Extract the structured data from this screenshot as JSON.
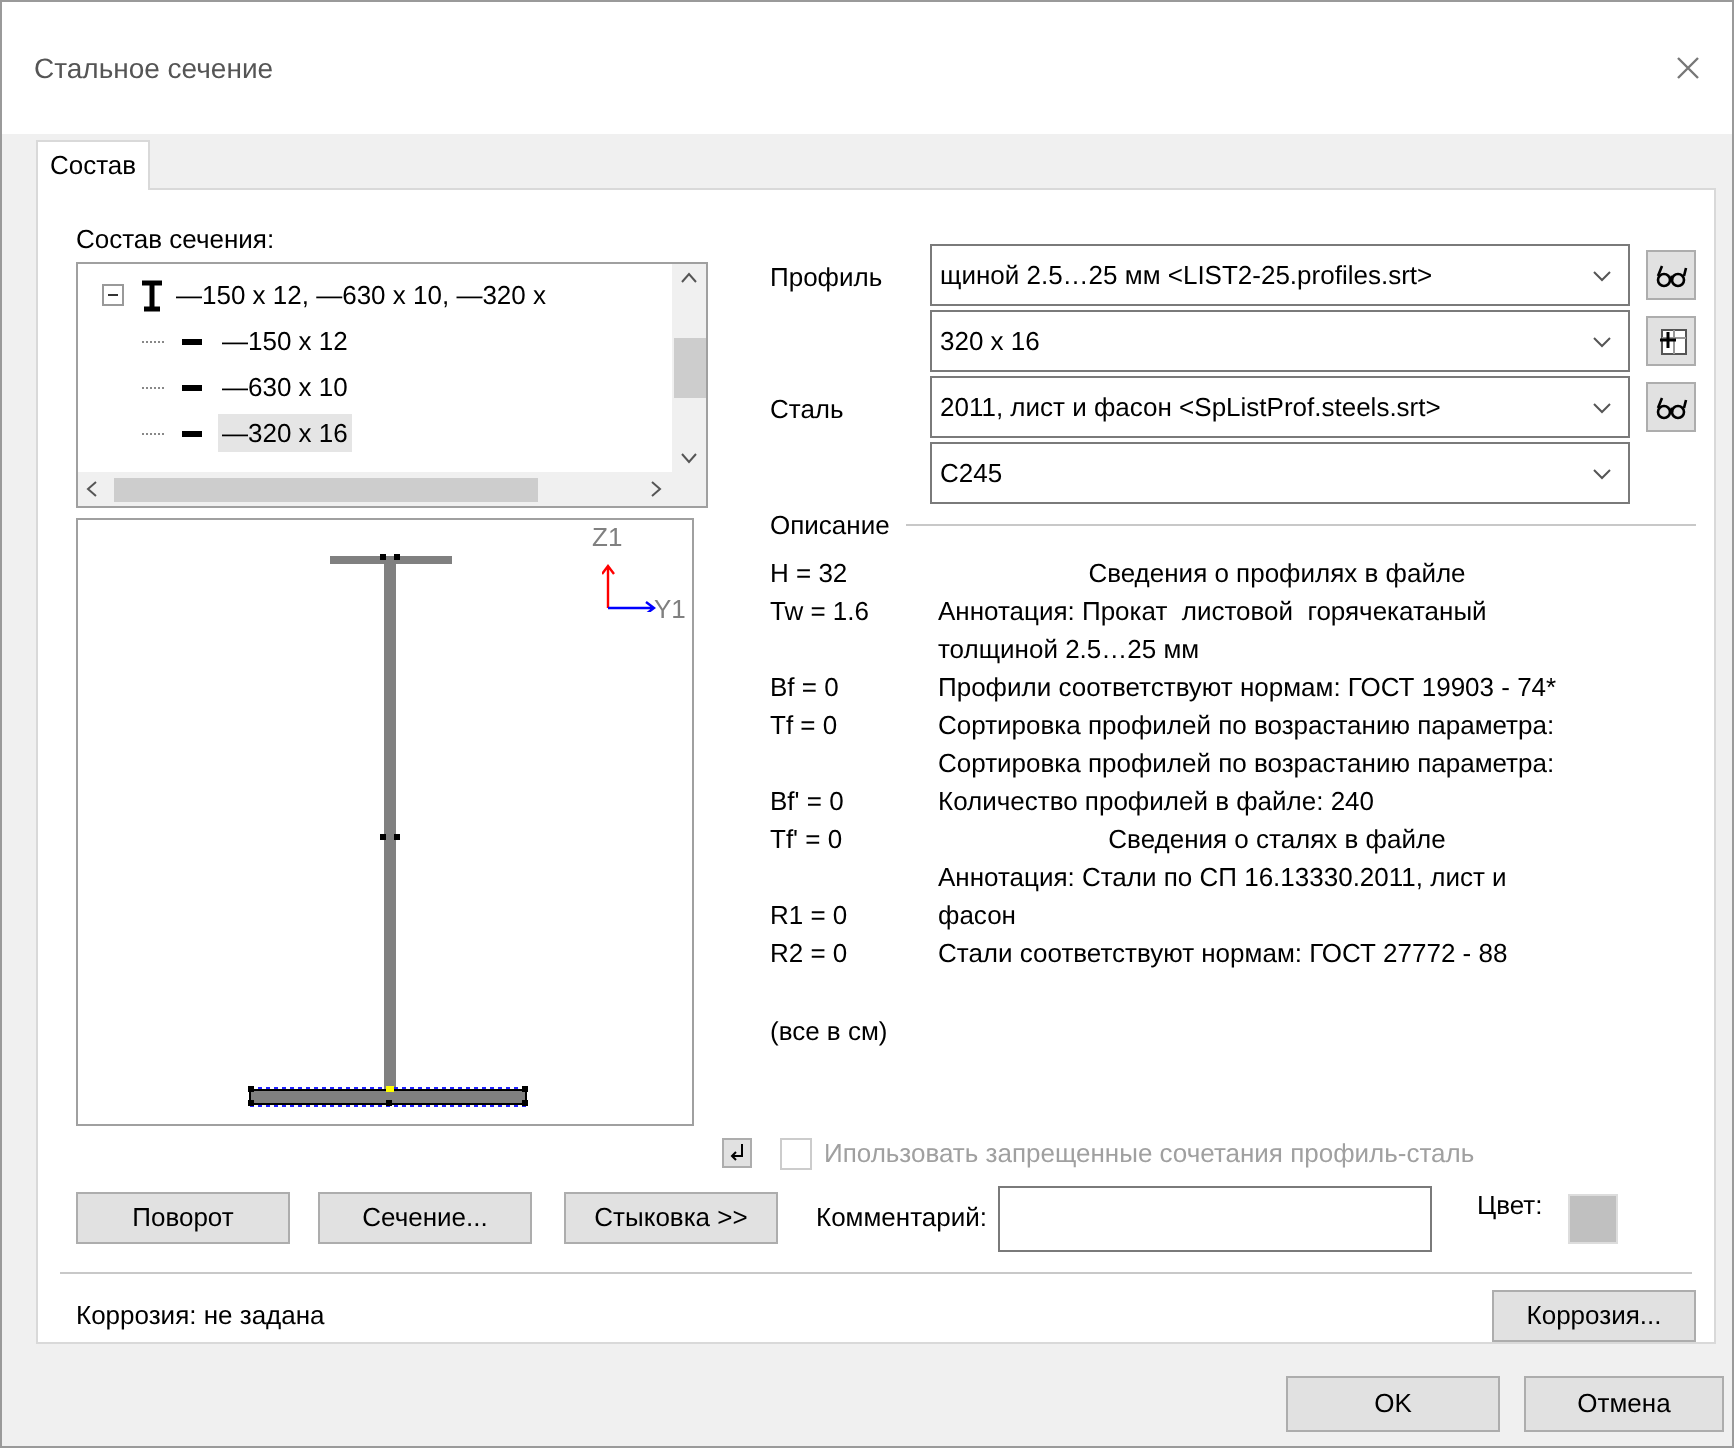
{
  "window": {
    "title": "Стальное сечение"
  },
  "tabs": [
    {
      "label": "Состав",
      "selected": true
    }
  ],
  "composition": {
    "label": "Состав сечения:",
    "tree": [
      {
        "label": "—150 x 12, —630 x 10, —320 x",
        "expanded": true,
        "selected": false,
        "children": [
          {
            "label": "—150 x 12",
            "selected": false
          },
          {
            "label": "—630 x 10",
            "selected": false
          },
          {
            "label": "—320 x 16",
            "selected": true
          }
        ]
      }
    ]
  },
  "profile": {
    "label": "Профиль",
    "file": "щиной 2.5…25 мм <LIST2-25.profiles.srt>",
    "size": "320 x 16"
  },
  "steel": {
    "label": "Сталь",
    "file": "2011, лист и фасон <SpListProf.steels.srt>",
    "grade": "C245"
  },
  "description": {
    "label": "Описание",
    "lines": [
      {
        "param": "H = 32",
        "text": "Сведения о профилях в файле",
        "kind": "header"
      },
      {
        "param": "Tw = 1.6",
        "text": "Аннотация: Прокат  листовой  горячекатаный",
        "kind": "line"
      },
      {
        "text": "толщиной 2.5…25 мм",
        "kind": "line"
      },
      {
        "param": "Bf = 0",
        "text": "Профили соответствуют нормам: ГОСТ 19903 - 74*",
        "kind": "line"
      },
      {
        "param": "Tf = 0",
        "text": "Сортировка профилей по возрастанию параметра:",
        "kind": "line"
      },
      {
        "text": "Сортировка профилей по возрастанию параметра:",
        "kind": "line"
      },
      {
        "param": "Bf' = 0",
        "text": "Количество профилей в файле: 240",
        "kind": "line"
      },
      {
        "param": "Tf' = 0",
        "text": "Сведения о сталях в файле",
        "kind": "header"
      },
      {
        "text": "Аннотация: Стали по СП 16.13330.2011, лист и",
        "kind": "line"
      },
      {
        "param": "R1 = 0",
        "text": "фасон",
        "kind": "line"
      },
      {
        "param": "R2 = 0",
        "text": "Стали соответствуют нормам: ГОСТ 27772 - 88",
        "kind": "line"
      }
    ],
    "units": "(все в см)"
  },
  "axes": {
    "z": "Z1",
    "y": "Y1"
  },
  "forbidden_combos": {
    "label": "Ипользовать запрещенные сочетания профиль-сталь",
    "checked": false,
    "disabled": true
  },
  "buttons": [
    "Поворот",
    "Сечение...",
    "Стыковка >>"
  ],
  "comment": {
    "label": "Комментарий:"
  },
  "color": {
    "label": "Цвет:",
    "color": "#c0c0c0"
  },
  "corrosion": {
    "status": "Коррозия: не задана",
    "button": "Коррозия..."
  },
  "dialog_buttons": [
    "OK",
    "Отмена"
  ]
}
